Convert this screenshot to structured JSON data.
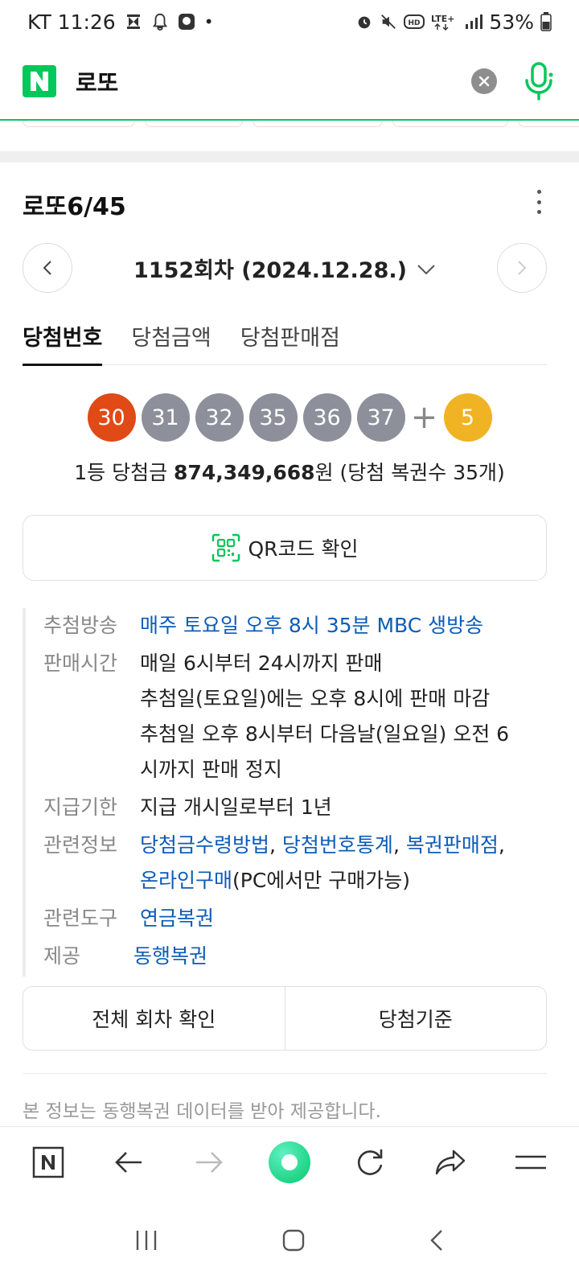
{
  "status_bar": {
    "carrier_time": "KT 11:26",
    "battery": "53%",
    "icons": [
      "cast-icon",
      "bell-icon",
      "app-icon",
      "alarm-icon",
      "mute-icon",
      "hd-icon",
      "lte-icon",
      "signal-icon",
      "battery-icon"
    ]
  },
  "search": {
    "query": "로또",
    "logo": "N"
  },
  "lotto": {
    "title": "로또6/45",
    "round": "1152회차 (2024.12.28.)",
    "tabs": [
      "당첨번호",
      "당첨금액",
      "당첨판매점"
    ],
    "numbers": [
      {
        "value": "30",
        "color": "#df4a16"
      },
      {
        "value": "31",
        "color": "#8d8f9a"
      },
      {
        "value": "32",
        "color": "#8d8f9a"
      },
      {
        "value": "35",
        "color": "#8d8f9a"
      },
      {
        "value": "36",
        "color": "#8d8f9a"
      },
      {
        "value": "37",
        "color": "#8d8f9a"
      }
    ],
    "plus": "+",
    "bonus": {
      "value": "5",
      "color": "#f0b323"
    },
    "prize_prefix": "1등 당첨금 ",
    "prize_amount": "874,349,668",
    "prize_suffix": "원 (당첨 복권수 35개)",
    "qr_label": "QR코드 확인"
  },
  "info": {
    "broadcast_label": "추첨방송",
    "broadcast_value": "매주 토요일 오후 8시 35분 MBC 생방송",
    "sales_label": "판매시간",
    "sales_lines": [
      "매일 6시부터 24시까지 판매",
      "추첨일(토요일)에는 오후 8시에 판매 마감",
      "추첨일 오후 8시부터 다음날(일요일) 오전 6",
      "시까지 판매 정지"
    ],
    "payout_label": "지급기한",
    "payout_value": "지급 개시일로부터 1년",
    "related_label": "관련정보",
    "related_link1": "당첨금수령방법",
    "related_link2": "당첨번호통계",
    "related_link3": "복권판매점",
    "related_link4": "온라인구매",
    "related_tail": "(PC에서만 구매가능)",
    "tools_label": "관련도구",
    "tools_value": "연금복권",
    "provider_label": "제공",
    "provider_value": "동행복권"
  },
  "buttons": {
    "all_rounds": "전체 회차 확인",
    "criteria": "당첨기준"
  },
  "footer_note": "본 정보는 동행복권 데이터를 받아 제공합니다.",
  "toolbar": {
    "home_logo": "N",
    "icons": [
      "naver-home-icon",
      "back-icon",
      "forward-icon",
      "green-dot-icon",
      "refresh-icon",
      "share-icon",
      "menu-icon"
    ]
  },
  "colors": {
    "naver_green": "#03c75a",
    "link_blue": "#0d5cb7"
  }
}
